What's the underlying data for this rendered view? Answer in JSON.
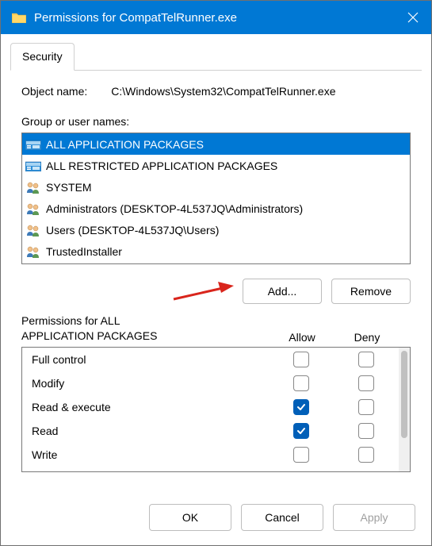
{
  "titlebar": {
    "title": "Permissions for CompatTelRunner.exe"
  },
  "tab": {
    "security": "Security"
  },
  "object": {
    "label": "Object name:",
    "value": "C:\\Windows\\System32\\CompatTelRunner.exe"
  },
  "groups": {
    "label": "Group or user names:",
    "items": [
      {
        "text": "ALL APPLICATION PACKAGES",
        "icon": "pkg",
        "selected": true
      },
      {
        "text": "ALL RESTRICTED APPLICATION PACKAGES",
        "icon": "pkg",
        "selected": false
      },
      {
        "text": "SYSTEM",
        "icon": "user",
        "selected": false
      },
      {
        "text": "Administrators (DESKTOP-4L537JQ\\Administrators)",
        "icon": "user",
        "selected": false
      },
      {
        "text": "Users (DESKTOP-4L537JQ\\Users)",
        "icon": "user",
        "selected": false
      },
      {
        "text": "TrustedInstaller",
        "icon": "user",
        "selected": false
      }
    ]
  },
  "buttons": {
    "add": "Add...",
    "remove": "Remove",
    "ok": "OK",
    "cancel": "Cancel",
    "apply": "Apply"
  },
  "perm": {
    "header_prefix": "Permissions for ALL",
    "header_suffix": "APPLICATION PACKAGES",
    "col_allow": "Allow",
    "col_deny": "Deny",
    "rows": [
      {
        "name": "Full control",
        "allow": false,
        "deny": false
      },
      {
        "name": "Modify",
        "allow": false,
        "deny": false
      },
      {
        "name": "Read & execute",
        "allow": true,
        "deny": false
      },
      {
        "name": "Read",
        "allow": true,
        "deny": false
      },
      {
        "name": "Write",
        "allow": false,
        "deny": false
      }
    ]
  }
}
